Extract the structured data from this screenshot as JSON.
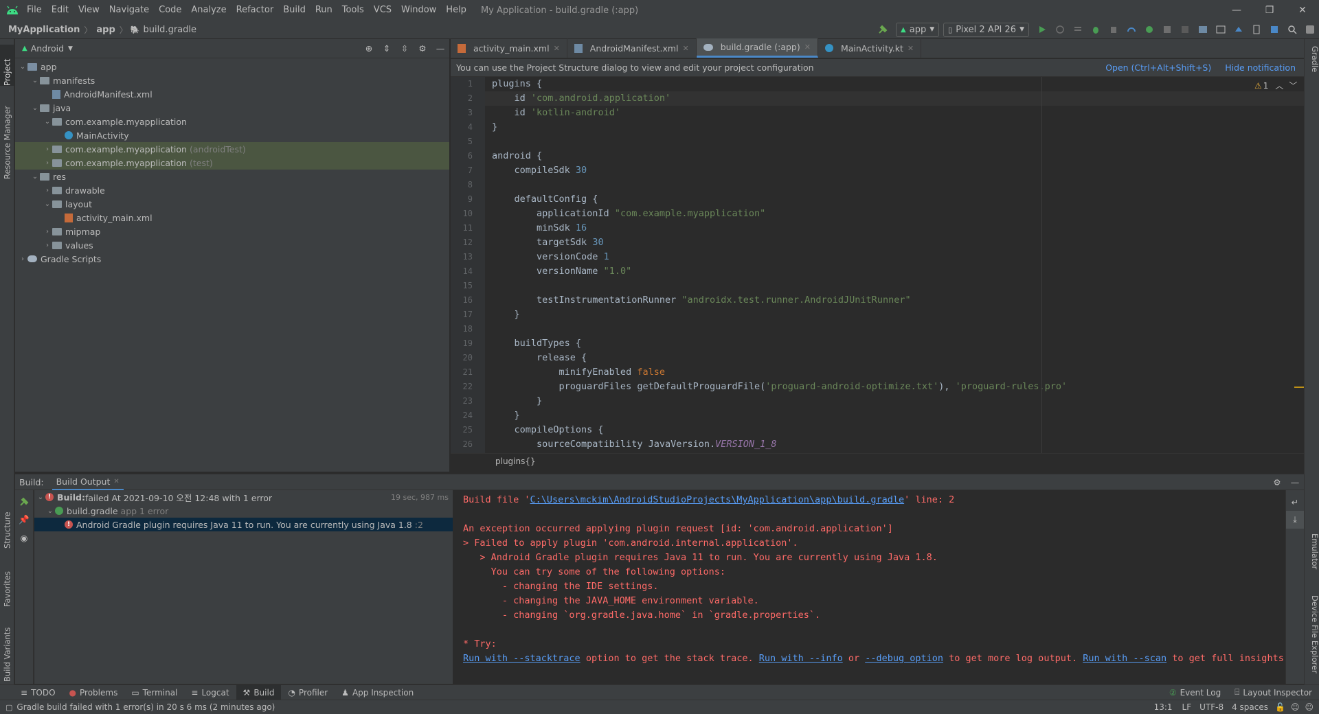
{
  "menu": [
    "File",
    "Edit",
    "View",
    "Navigate",
    "Code",
    "Analyze",
    "Refactor",
    "Build",
    "Run",
    "Tools",
    "VCS",
    "Window",
    "Help"
  ],
  "window_title": "My Application - build.gradle (:app)",
  "breadcrumb": [
    "MyApplication",
    "app",
    "build.gradle"
  ],
  "run_config": "app",
  "device": "Pixel 2 API 26",
  "left_stripe": [
    "Project",
    "Resource Manager",
    "Structure",
    "Favorites",
    "Build Variants"
  ],
  "right_stripe": [
    "Gradle",
    "Emulator",
    "Device File Explorer"
  ],
  "project_view": "Android",
  "tree": [
    {
      "label": "app",
      "depth": 0,
      "chev": "v",
      "icon": "module"
    },
    {
      "label": "manifests",
      "depth": 1,
      "chev": "v",
      "icon": "folder"
    },
    {
      "label": "AndroidManifest.xml",
      "depth": 2,
      "chev": "",
      "icon": "manifest"
    },
    {
      "label": "java",
      "depth": 1,
      "chev": "v",
      "icon": "folder"
    },
    {
      "label": "com.example.myapplication",
      "depth": 2,
      "chev": "v",
      "icon": "package"
    },
    {
      "label": "MainActivity",
      "depth": 3,
      "chev": "",
      "icon": "kotlin"
    },
    {
      "label": "com.example.myapplication",
      "suffix": "(androidTest)",
      "depth": 2,
      "chev": ">",
      "icon": "package",
      "hl": true
    },
    {
      "label": "com.example.myapplication",
      "suffix": "(test)",
      "depth": 2,
      "chev": ">",
      "icon": "package",
      "hl": true
    },
    {
      "label": "res",
      "depth": 1,
      "chev": "v",
      "icon": "folder"
    },
    {
      "label": "drawable",
      "depth": 2,
      "chev": ">",
      "icon": "folder"
    },
    {
      "label": "layout",
      "depth": 2,
      "chev": "v",
      "icon": "folder"
    },
    {
      "label": "activity_main.xml",
      "depth": 3,
      "chev": "",
      "icon": "xml"
    },
    {
      "label": "mipmap",
      "depth": 2,
      "chev": ">",
      "icon": "folder"
    },
    {
      "label": "values",
      "depth": 2,
      "chev": ">",
      "icon": "folder"
    },
    {
      "label": "Gradle Scripts",
      "depth": 0,
      "chev": ">",
      "icon": "gradle"
    }
  ],
  "editor_tabs": [
    {
      "label": "activity_main.xml",
      "icon": "xml"
    },
    {
      "label": "AndroidManifest.xml",
      "icon": "manifest"
    },
    {
      "label": "build.gradle (:app)",
      "icon": "gradle",
      "active": true
    },
    {
      "label": "MainActivity.kt",
      "icon": "kotlin"
    }
  ],
  "notification": {
    "text": "You can use the Project Structure dialog to view and edit your project configuration",
    "open": "Open (Ctrl+Alt+Shift+S)",
    "hide": "Hide notification"
  },
  "warnings": "1",
  "code_lines": [
    [
      [
        "p",
        "plugins {"
      ]
    ],
    [
      [
        "p",
        "    id "
      ],
      [
        "s",
        "'com.android.application'"
      ]
    ],
    [
      [
        "p",
        "    id "
      ],
      [
        "s",
        "'kotlin-android'"
      ]
    ],
    [
      [
        "p",
        "}"
      ]
    ],
    [
      [
        "p",
        ""
      ]
    ],
    [
      [
        "p",
        "android {"
      ]
    ],
    [
      [
        "p",
        "    compileSdk "
      ],
      [
        "n",
        "30"
      ]
    ],
    [
      [
        "p",
        ""
      ]
    ],
    [
      [
        "p",
        "    defaultConfig {"
      ]
    ],
    [
      [
        "p",
        "        applicationId "
      ],
      [
        "s",
        "\"com.example.myapplication\""
      ]
    ],
    [
      [
        "p",
        "        minSdk "
      ],
      [
        "n",
        "16"
      ]
    ],
    [
      [
        "p",
        "        targetSdk "
      ],
      [
        "n",
        "30"
      ]
    ],
    [
      [
        "p",
        "        versionCode "
      ],
      [
        "n",
        "1"
      ]
    ],
    [
      [
        "p",
        "        versionName "
      ],
      [
        "s",
        "\"1.0\""
      ]
    ],
    [
      [
        "p",
        ""
      ]
    ],
    [
      [
        "p",
        "        testInstrumentationRunner "
      ],
      [
        "s",
        "\"androidx.test.runner.AndroidJUnitRunner\""
      ]
    ],
    [
      [
        "p",
        "    }"
      ]
    ],
    [
      [
        "p",
        ""
      ]
    ],
    [
      [
        "p",
        "    buildTypes {"
      ]
    ],
    [
      [
        "p",
        "        release {"
      ]
    ],
    [
      [
        "p",
        "            minifyEnabled "
      ],
      [
        "k",
        "false"
      ]
    ],
    [
      [
        "p",
        "            proguardFiles getDefaultProguardFile("
      ],
      [
        "s",
        "'proguard-android-optimize.txt'"
      ],
      [
        "p",
        "), "
      ],
      [
        "s",
        "'proguard-rules.pro'"
      ]
    ],
    [
      [
        "p",
        "        }"
      ]
    ],
    [
      [
        "p",
        "    }"
      ]
    ],
    [
      [
        "p",
        "    compileOptions {"
      ]
    ],
    [
      [
        "p",
        "        sourceCompatibility JavaVersion."
      ],
      [
        "i",
        "VERSION_1_8"
      ]
    ]
  ],
  "editor_breadcrumb": "plugins{}",
  "build": {
    "label": "Build:",
    "tab": "Build Output",
    "tree": [
      {
        "bold": "Build:",
        "text": " failed At 2021-09-10 오전 12:48 with 1 error",
        "time": "19 sec, 987 ms",
        "depth": 0
      },
      {
        "bold": "",
        "text": "build.gradle",
        "muted": " app 1 error",
        "depth": 1
      },
      {
        "bold": "",
        "text": "Android Gradle plugin requires Java 11 to run. You are currently using Java 1.8",
        "muted": " :2",
        "depth": 2,
        "sel": true
      }
    ],
    "output": [
      [
        [
          "t",
          "Build file '"
        ],
        [
          "u",
          "C:\\Users\\mckim\\AndroidStudioProjects\\MyApplication\\app\\build.gradle"
        ],
        [
          "t",
          "' line: 2"
        ]
      ],
      [
        [
          "t",
          ""
        ]
      ],
      [
        [
          "t",
          "An exception occurred applying plugin request [id: 'com.android.application']"
        ]
      ],
      [
        [
          "t",
          "> Failed to apply plugin 'com.android.internal.application'."
        ]
      ],
      [
        [
          "t",
          "   > Android Gradle plugin requires Java 11 to run. You are currently using Java 1.8."
        ]
      ],
      [
        [
          "t",
          "     You can try some of the following options:"
        ]
      ],
      [
        [
          "t",
          "       - changing the IDE settings."
        ]
      ],
      [
        [
          "t",
          "       - changing the JAVA_HOME environment variable."
        ]
      ],
      [
        [
          "t",
          "       - changing `org.gradle.java.home` in `gradle.properties`."
        ]
      ],
      [
        [
          "t",
          ""
        ]
      ],
      [
        [
          "t",
          "* Try:"
        ]
      ],
      [
        [
          "u",
          "Run with --stacktrace"
        ],
        [
          "t",
          " option to get the stack trace. "
        ],
        [
          "u",
          "Run with --info"
        ],
        [
          "t",
          " or "
        ],
        [
          "u",
          "--debug option"
        ],
        [
          "t",
          " to get more log output. "
        ],
        [
          "u",
          "Run with --scan"
        ],
        [
          "t",
          " to get full insights."
        ]
      ]
    ]
  },
  "bottom_tabs": [
    "TODO",
    "Problems",
    "Terminal",
    "Logcat",
    "Build",
    "Profiler",
    "App Inspection"
  ],
  "bottom_right_tabs": [
    "Event Log",
    "Layout Inspector"
  ],
  "status": {
    "message": "Gradle build failed with 1 error(s) in 20 s 6 ms (2 minutes ago)",
    "position": "13:1",
    "line_sep": "LF",
    "encoding": "UTF-8",
    "indent": "4 spaces"
  },
  "colors": {
    "error": "#ff6b68",
    "link": "#589df6",
    "accent": "#4a88c7"
  }
}
